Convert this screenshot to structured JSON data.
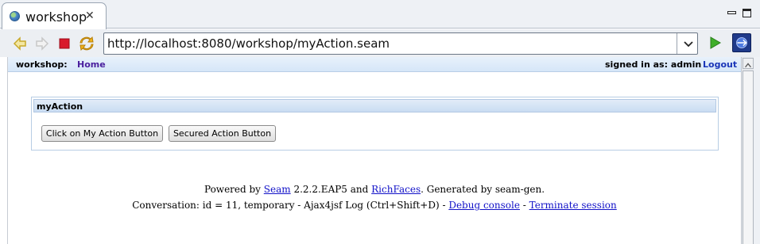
{
  "editor": {
    "tab_title": "workshop",
    "icons": {
      "tab": "globe-icon",
      "close": "close-icon",
      "minimize": "minimize-icon",
      "maximize": "maximize-icon"
    }
  },
  "navigation": {
    "url": "http://localhost:8080/workshop/myAction.seam",
    "icons": [
      "back-icon",
      "forward-icon",
      "stop-icon",
      "refresh-icon",
      "dropdown-icon",
      "go-icon",
      "external-browser-icon"
    ]
  },
  "page": {
    "menubar": {
      "app_label": "workshop:",
      "home_link": "Home",
      "signed_in": "signed in as: admin",
      "logout_link": "Logout"
    },
    "panel": {
      "title": "myAction",
      "buttons": [
        "Click on My Action Button",
        "Secured Action Button"
      ]
    },
    "footer": {
      "powered_prefix": "Powered by ",
      "seam_link": "Seam",
      "version_text": " 2.2.2.EAP5 and ",
      "richfaces_link": "RichFaces",
      "generated_text": ". Generated by seam-gen.",
      "conversation_text": "Conversation: id = 11, temporary - Ajax4jsf Log (Ctrl+Shift+D) - ",
      "debug_link": "Debug console",
      "dash": " - ",
      "terminate_link": "Terminate session"
    }
  },
  "colors": {
    "link": "#1212c8",
    "visited_link": "#4a1f9e",
    "header_blue": "#c9dcf2"
  }
}
